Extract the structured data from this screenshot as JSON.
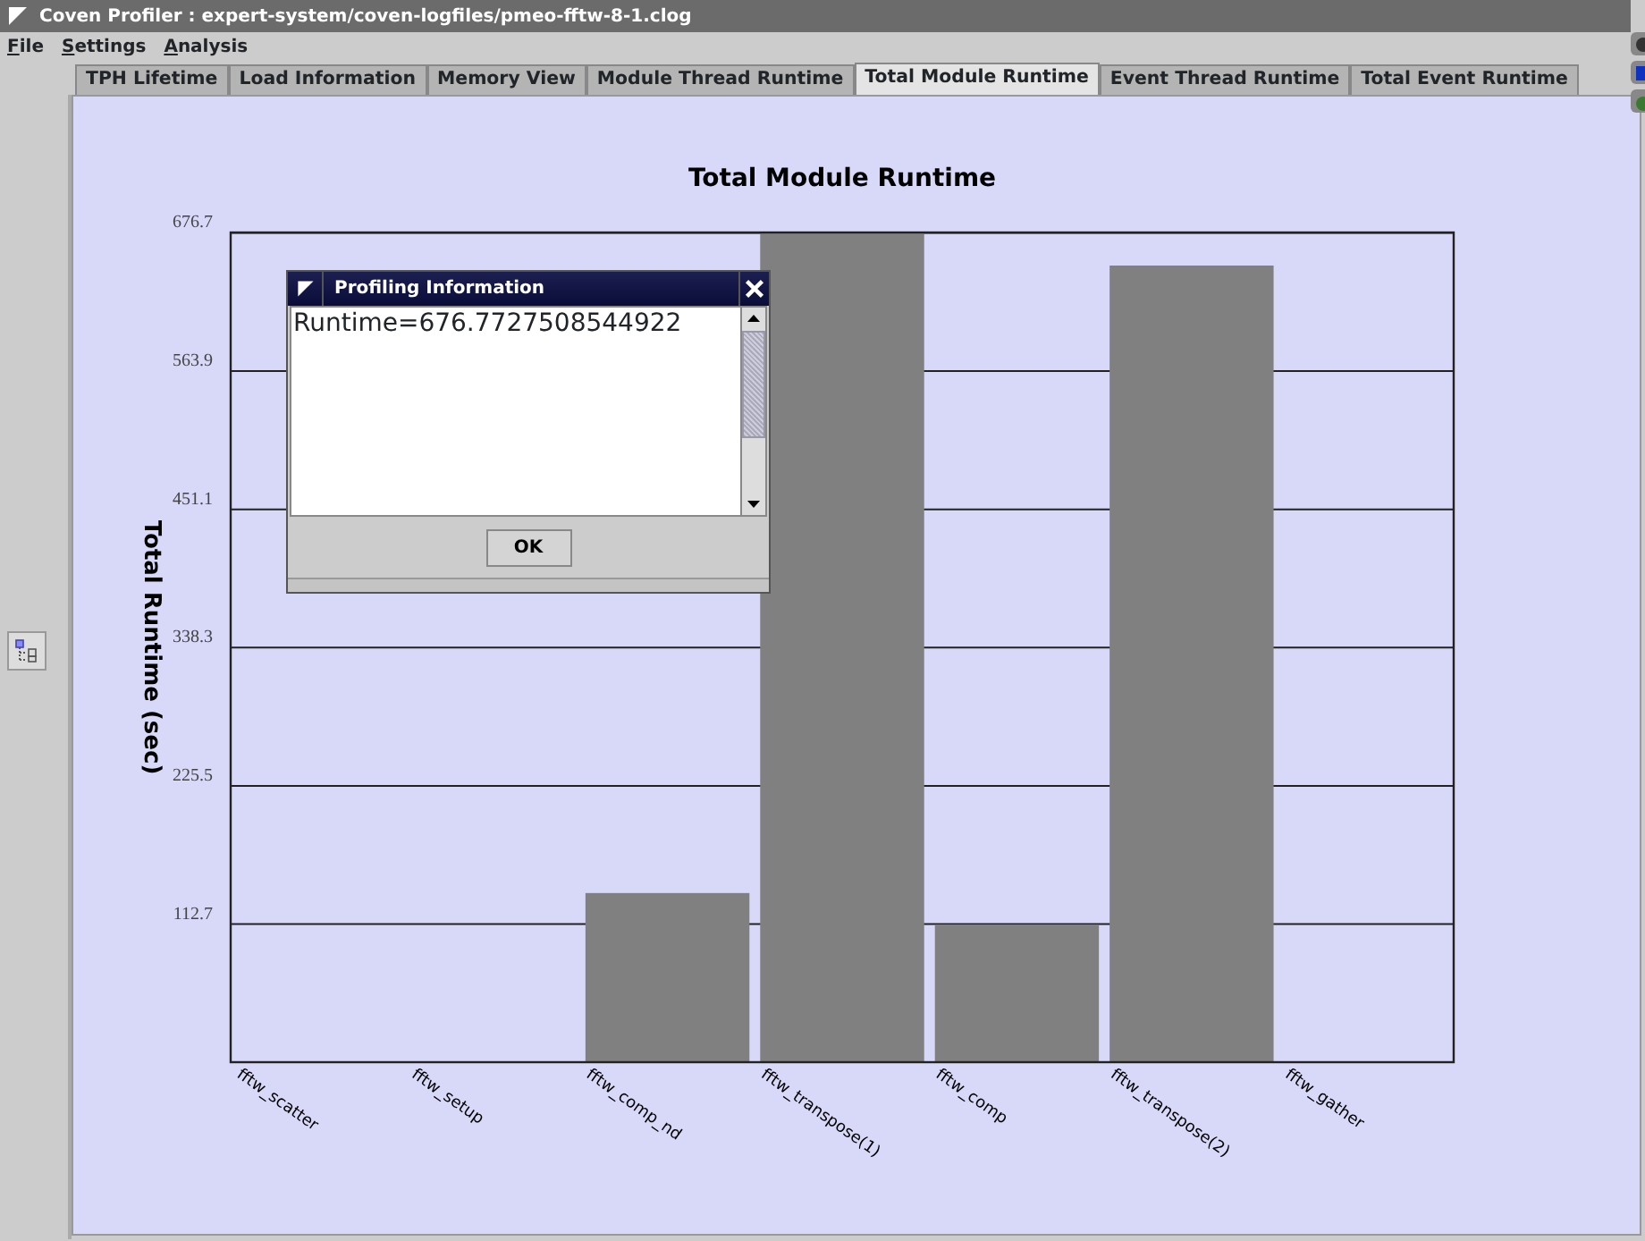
{
  "window": {
    "title": "Coven Profiler : expert-system/coven-logfiles/pmeo-fftw-8-1.clog"
  },
  "menu": [
    "File",
    "Settings",
    "Analysis"
  ],
  "tabs": [
    {
      "label": "TPH Lifetime",
      "selected": false
    },
    {
      "label": "Load Information",
      "selected": false
    },
    {
      "label": "Memory View",
      "selected": false
    },
    {
      "label": "Module Thread Runtime",
      "selected": false
    },
    {
      "label": "Total Module Runtime",
      "selected": true
    },
    {
      "label": "Event Thread Runtime",
      "selected": false
    },
    {
      "label": "Total Event Runtime",
      "selected": false
    }
  ],
  "chart": {
    "chart_data": {
      "type": "bar",
      "title": "Total Module Runtime",
      "ylabel": "Total Runtime (sec)",
      "categories": [
        "fftw_scatter",
        "fftw_setup",
        "fftw_comp_nd",
        "fftw_transpose(1)",
        "fftw_comp",
        "fftw_transpose(2)",
        "fftw_gather"
      ],
      "values": [
        0,
        0,
        138,
        677,
        112,
        650,
        0
      ],
      "ylim": [
        0,
        677
      ],
      "grid": true,
      "yticks": [
        {
          "value": 112.7,
          "label": "112.7"
        },
        {
          "value": 225.5,
          "label": "225.5"
        },
        {
          "value": 338.3,
          "label": "338.3"
        },
        {
          "value": 451.1,
          "label": "451.1"
        },
        {
          "value": 563.9,
          "label": "563.9"
        },
        {
          "value": 676.7,
          "label": "676.7"
        }
      ]
    }
  },
  "dialog": {
    "title": "Profiling Information",
    "text": "Runtime=676.7727508544922",
    "button": "OK"
  }
}
